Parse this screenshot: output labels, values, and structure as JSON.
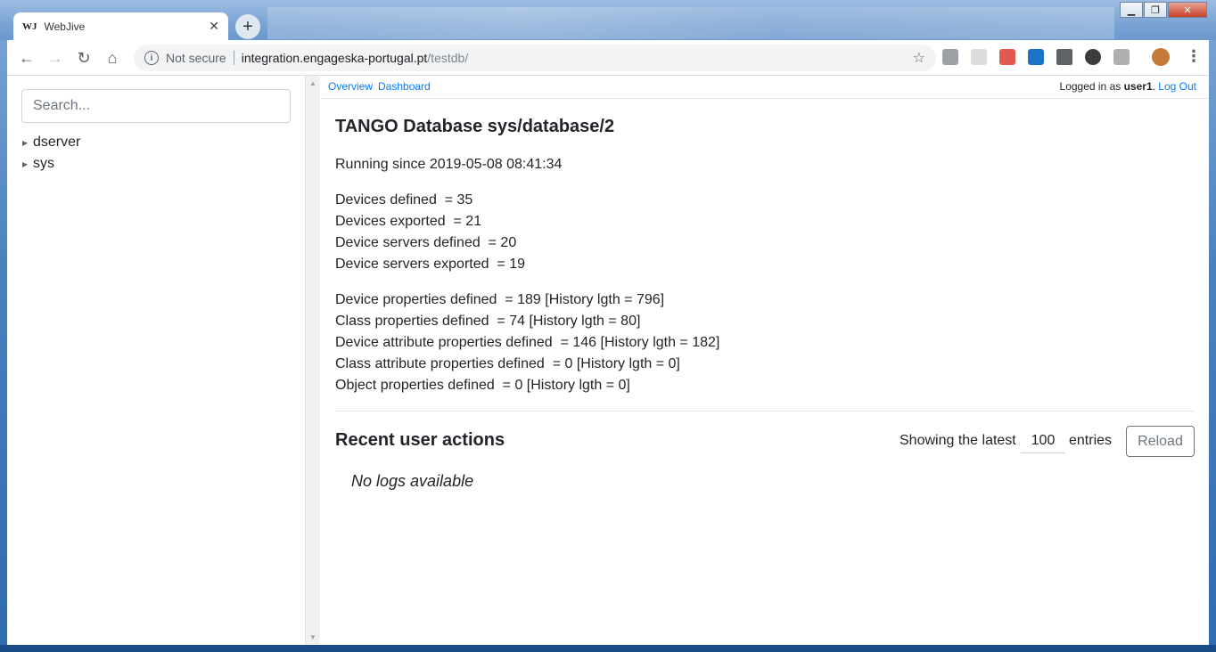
{
  "browser": {
    "tab_title": "WebJive",
    "tab_favicon": "WJ",
    "new_tab_icon": "+",
    "security_label": "Not secure",
    "url_host": "integration.engageska-portugal.pt",
    "url_path": "/testdb/",
    "window_controls": [
      "minimize-icon",
      "maximize-icon",
      "close-icon"
    ]
  },
  "sidebar": {
    "search_placeholder": "Search...",
    "tree": [
      {
        "label": "dserver"
      },
      {
        "label": "sys"
      }
    ]
  },
  "topnav": {
    "overview": "Overview",
    "dashboard": "Dashboard",
    "logged_in_prefix": "Logged in as",
    "username": "user1",
    "logout": "Log Out"
  },
  "database": {
    "title": "TANGO Database sys/database/2",
    "running_since": "Running since 2019-05-08 08:41:34",
    "stats": [
      "Devices defined  = 35",
      "Devices exported  = 21",
      "Device servers defined  = 20",
      "Device servers exported  = 19"
    ],
    "properties": [
      "Device properties defined  = 189 [History lgth = 796]",
      "Class properties defined  = 74 [History lgth = 80]",
      "Device attribute properties defined  = 146 [History lgth = 182]",
      "Class attribute properties defined  = 0 [History lgth = 0]",
      "Object properties defined  = 0 [History lgth = 0]"
    ]
  },
  "recent": {
    "title": "Recent user actions",
    "showing_label": "Showing the latest",
    "entries_value": "100",
    "entries_label": "entries",
    "reload_label": "Reload",
    "empty_message": "No logs available"
  },
  "colors": {
    "link": "#007bff",
    "text": "#212529",
    "frame": "#2f6bb0"
  }
}
